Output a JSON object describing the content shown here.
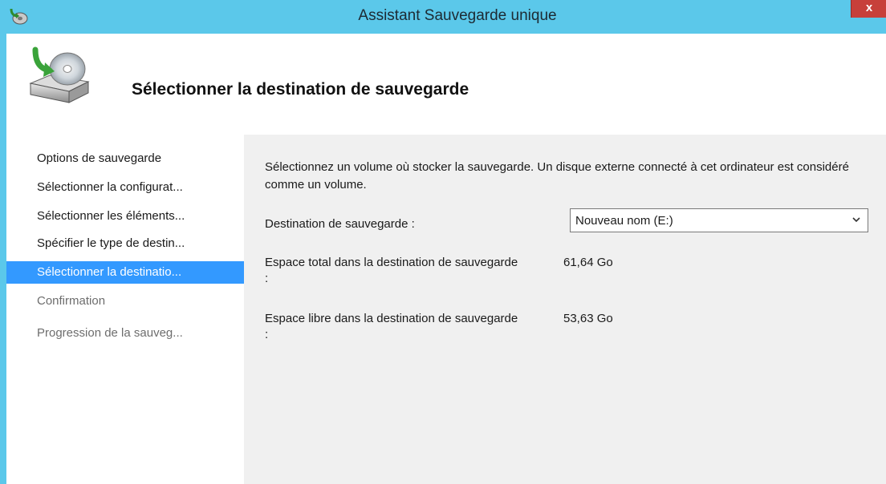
{
  "window": {
    "title": "Assistant Sauvegarde unique",
    "close_label": "x"
  },
  "header": {
    "title": "Sélectionner la destination de sauvegarde",
    "icon": "backup-disk-icon"
  },
  "steps": [
    {
      "label": "Options de sauvegarde",
      "state": "done"
    },
    {
      "label": "Sélectionner la configurat...",
      "state": "done"
    },
    {
      "label": "Sélectionner les éléments...",
      "state": "done"
    },
    {
      "label": "Spécifier le type de destin...",
      "state": "done"
    },
    {
      "label": "Sélectionner la destinatio...",
      "state": "active"
    },
    {
      "label": "Confirmation",
      "state": "disabled"
    },
    {
      "label": "Progression de la sauveg...",
      "state": "disabled"
    }
  ],
  "content": {
    "description": "Sélectionnez un volume où stocker la sauvegarde. Un disque externe connecté à cet ordinateur est considéré comme un volume.",
    "destination_label": "Destination de sauvegarde :",
    "destination_value": "Nouveau nom (E:)",
    "total_space_label": "Espace total dans la destination de sauvegarde :",
    "total_space_value": "61,64 Go",
    "free_space_label": "Espace libre dans la destination de sauvegarde :",
    "free_space_value": "53,63 Go"
  },
  "colors": {
    "titlebar": "#5bc8ea",
    "selection": "#3399ff",
    "close": "#c7403a"
  }
}
